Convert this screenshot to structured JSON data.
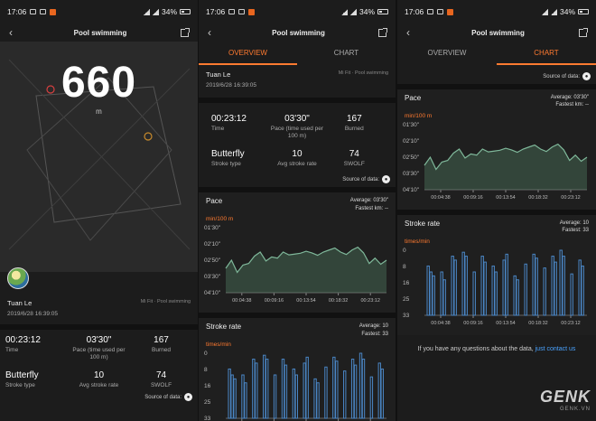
{
  "status": {
    "time": "17:06",
    "battery": "34%"
  },
  "screen_title": "Pool swimming",
  "tabs": {
    "overview": "OVERVIEW",
    "chart": "CHART"
  },
  "hero": {
    "distance": "660",
    "unit": "m"
  },
  "user": {
    "name": "Tuan Le",
    "date": "2019/6/28 16:39:05",
    "source_app": "Mi Fit · Pool swimming"
  },
  "stats": {
    "time_value": "00:23:12",
    "time_label": "Time",
    "pace_value": "03'30\"",
    "pace_label": "Pace (time used per 100 m)",
    "burned_value": "167",
    "burned_label": "Burned",
    "stroke_value": "Butterfly",
    "stroke_label": "Stroke type",
    "rate_value": "10",
    "rate_label": "Avg stroke rate",
    "swolf_value": "74",
    "swolf_label": "SWOLF"
  },
  "source_of_data": "Source of data:",
  "pace_card": {
    "title": "Pace",
    "average": "Average: 03'30\"",
    "fastest": "Fastest km: --",
    "unit": "min/100 m"
  },
  "stroke_card": {
    "title": "Stroke rate",
    "average": "Average: 10",
    "fastest": "Fastest: 33",
    "unit": "times/min"
  },
  "contact": {
    "text": "If you have any questions about the data,",
    "link": "just contact us"
  },
  "watermark": {
    "main": "GENK",
    "sub": "GENK.VN"
  },
  "colors": {
    "accent": "#ff7a30",
    "pace_line": "#7fb89a",
    "stroke_bars": "#4a86c5",
    "background": "#1c1c1c"
  },
  "chart_data": [
    {
      "type": "area",
      "title": "Pace",
      "ylabel": "min/100 m",
      "y_ticks": [
        "01'30\"",
        "02'10\"",
        "02'50\"",
        "03'30\"",
        "04'10\""
      ],
      "x_ticks": [
        "00:04:38",
        "00:09:16",
        "00:13:54",
        "00:18:32",
        "00:23:12"
      ],
      "ylim": [
        90,
        250
      ],
      "y_inverted": true,
      "series": [
        {
          "values": [
            190,
            170,
            200,
            182,
            178,
            160,
            150,
            172,
            162,
            165,
            150,
            157,
            155,
            153,
            148,
            152,
            158,
            150,
            145,
            140,
            150,
            156,
            145,
            138,
            152,
            178,
            165,
            180,
            170
          ]
        }
      ]
    },
    {
      "type": "bar",
      "title": "Stroke rate",
      "ylabel": "times/min",
      "y_ticks": [
        "0",
        "8",
        "16",
        "25",
        "33"
      ],
      "x_ticks": [
        "00:04:38",
        "00:09:16",
        "00:13:54",
        "00:18:32",
        "00:23:12"
      ],
      "ylim": [
        0,
        33
      ],
      "series": [
        {
          "values": [
            0,
            25,
            22,
            20,
            0,
            0,
            22,
            18,
            0,
            0,
            30,
            28,
            0,
            0,
            32,
            30,
            0,
            0,
            22,
            0,
            0,
            30,
            27,
            0,
            0,
            25,
            22,
            0,
            0,
            28,
            31,
            0,
            0,
            20,
            18,
            0,
            0,
            26,
            0,
            0,
            31,
            29,
            0,
            0,
            24,
            0,
            0,
            30,
            27,
            0,
            33,
            30,
            0,
            0,
            21,
            0,
            0,
            28,
            25,
            0
          ]
        }
      ]
    }
  ]
}
